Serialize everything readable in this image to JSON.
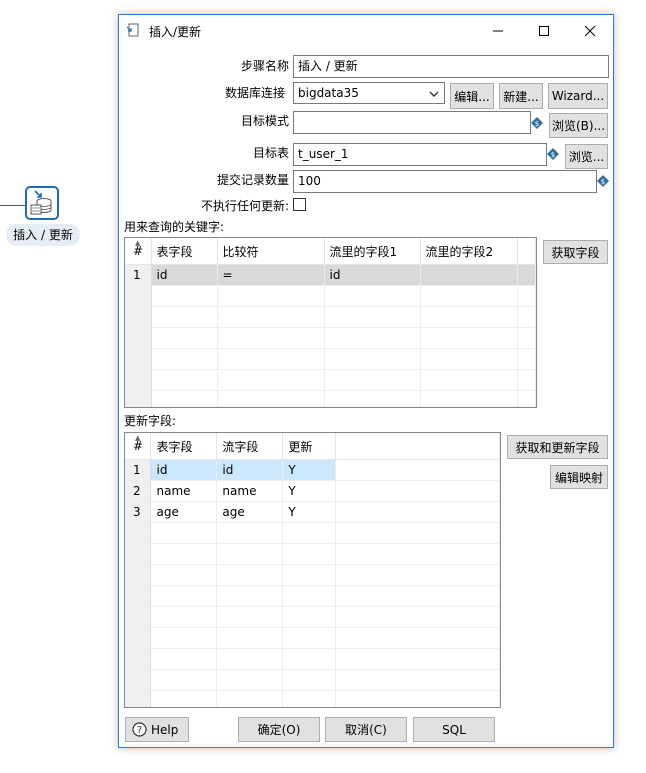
{
  "canvas": {
    "step_label": "插入 / 更新"
  },
  "dialog": {
    "title": "插入/更新",
    "window_buttons": {
      "minimize": "—",
      "maximize": "☐",
      "close": "✕"
    }
  },
  "form": {
    "step_name_label": "步骤名称",
    "step_name_value": "插入 / 更新",
    "db_conn_label": "数据库连接",
    "db_conn_value": "bigdata35",
    "edit_button": "编辑...",
    "new_button": "新建...",
    "wizard_button": "Wizard...",
    "target_schema_label": "目标模式",
    "target_schema_value": "",
    "browse_schema_button": "浏览(B)...",
    "target_table_label": "目标表",
    "target_table_value": "t_user_1",
    "browse_table_button": "浏览...",
    "commit_size_label": "提交记录数量",
    "commit_size_value": "100",
    "no_update_label": "不执行任何更新:",
    "no_update_checked": false
  },
  "key_section": {
    "label": "用来查询的关键字:",
    "get_fields_button": "获取字段",
    "columns": [
      "#",
      "表字段",
      "比较符",
      "流里的字段1",
      "流里的字段2"
    ],
    "rows": [
      [
        "1",
        "id",
        "=",
        "id",
        ""
      ]
    ]
  },
  "update_section": {
    "label": "更新字段:",
    "get_update_fields_button": "获取和更新字段",
    "edit_mapping_button": "编辑映射",
    "columns": [
      "#",
      "表字段",
      "流字段",
      "更新"
    ],
    "rows": [
      [
        "1",
        "id",
        "id",
        "Y"
      ],
      [
        "2",
        "name",
        "name",
        "Y"
      ],
      [
        "3",
        "age",
        "age",
        "Y"
      ]
    ]
  },
  "footer": {
    "help_button": "Help",
    "ok_button": "确定(O)",
    "cancel_button": "取消(C)",
    "sql_button": "SQL"
  }
}
